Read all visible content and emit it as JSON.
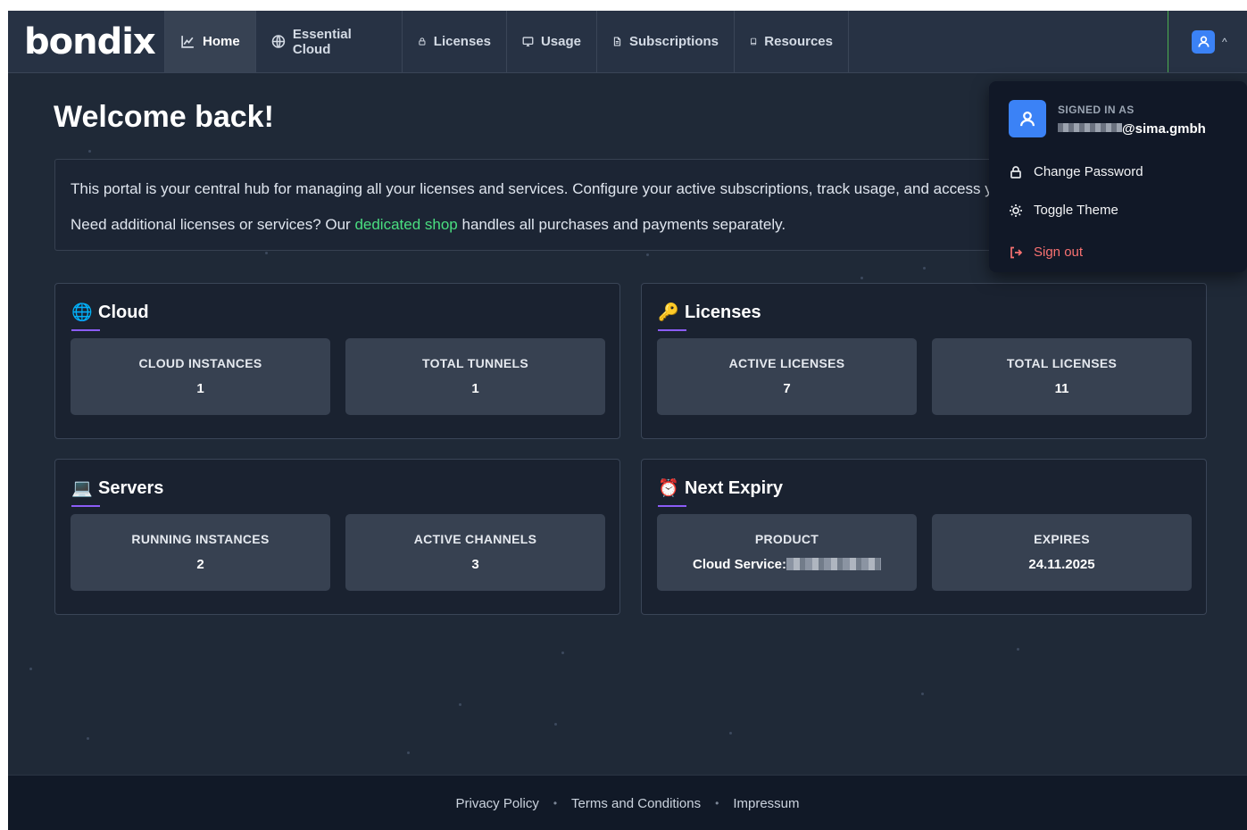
{
  "brand": {
    "logo_text": "bondix"
  },
  "nav": {
    "items": [
      {
        "label": "Home",
        "icon": "chart-line-icon",
        "active": true
      },
      {
        "label": "Essential Cloud",
        "icon": "globe-icon"
      },
      {
        "label": "Licenses",
        "icon": "lock-icon"
      },
      {
        "label": "Usage",
        "icon": "monitor-icon"
      },
      {
        "label": "Subscriptions",
        "icon": "document-icon"
      },
      {
        "label": "Resources",
        "icon": "book-icon"
      }
    ],
    "user_caret": "^"
  },
  "main": {
    "welcome": "Welcome back!",
    "intro_line1": "This portal is your central hub for managing all your licenses and services. Configure your active subscriptions, track usage, and access your licenses.",
    "intro_line2_before": "Need additional licenses or services? Our ",
    "intro_link": "dedicated shop",
    "intro_line2_after": " handles all purchases and payments separately."
  },
  "cards": {
    "cloud": {
      "title": "Cloud",
      "emoji": "🌐",
      "stats": [
        {
          "label": "CLOUD INSTANCES",
          "value": "1"
        },
        {
          "label": "TOTAL TUNNELS",
          "value": "1"
        }
      ]
    },
    "licenses": {
      "title": "Licenses",
      "emoji": "🔑",
      "stats": [
        {
          "label": "ACTIVE LICENSES",
          "value": "7"
        },
        {
          "label": "TOTAL LICENSES",
          "value": "11"
        }
      ]
    },
    "servers": {
      "title": "Servers",
      "emoji": "💻",
      "stats": [
        {
          "label": "RUNNING INSTANCES",
          "value": "2"
        },
        {
          "label": "ACTIVE CHANNELS",
          "value": "3"
        }
      ]
    },
    "expiry": {
      "title": "Next Expiry",
      "emoji": "⏰",
      "stats": [
        {
          "label": "PRODUCT",
          "value": "Cloud Service:"
        },
        {
          "label": "EXPIRES",
          "value": "24.11.2025"
        }
      ]
    }
  },
  "footer": {
    "links": [
      "Privacy Policy",
      "Terms and Conditions",
      "Impressum"
    ],
    "separator": "•"
  },
  "user_menu": {
    "signed_in_as": "SIGNED IN AS",
    "email_suffix": "@sima.gmbh",
    "items": [
      {
        "label": "Change Password",
        "icon": "lock-icon"
      },
      {
        "label": "Toggle Theme",
        "icon": "sun-icon"
      },
      {
        "label": "Sign out",
        "icon": "sign-out-icon"
      }
    ]
  },
  "colors": {
    "accent": "#3b82f6",
    "link": "#4ade80",
    "underline": "#8b5cf6",
    "danger": "#f87171"
  }
}
